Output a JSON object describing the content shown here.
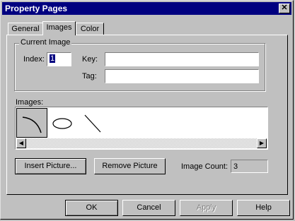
{
  "window": {
    "title": "Property Pages",
    "close_glyph": "✕"
  },
  "tabs": [
    {
      "label": "General"
    },
    {
      "label": "Images"
    },
    {
      "label": "Color"
    }
  ],
  "current_image": {
    "group_label": "Current Image",
    "index_label": "Index:",
    "index_value": "1",
    "key_label": "Key:",
    "key_value": "",
    "tag_label": "Tag:",
    "tag_value": ""
  },
  "images": {
    "label": "Images:",
    "items": [
      "curve-icon",
      "ellipse-icon",
      "diagonal-line-icon"
    ],
    "scroll_left_glyph": "◀",
    "scroll_right_glyph": "▶"
  },
  "actions": {
    "insert_label": "Insert Picture...",
    "remove_label": "Remove Picture",
    "count_label": "Image Count:",
    "count_value": "3"
  },
  "buttons": {
    "ok": "OK",
    "cancel": "Cancel",
    "apply": "Apply",
    "help": "Help"
  }
}
